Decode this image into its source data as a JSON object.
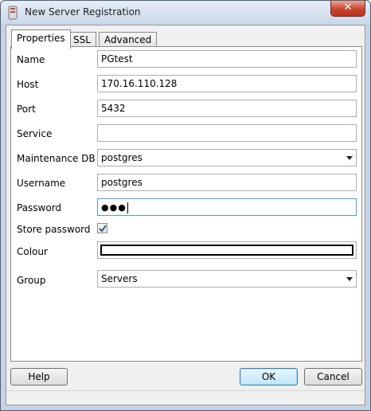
{
  "window": {
    "title": "New Server Registration",
    "close_glyph": "✕"
  },
  "tabs": [
    {
      "label": "Properties"
    },
    {
      "label": "SSL"
    },
    {
      "label": "Advanced"
    }
  ],
  "form": {
    "name": {
      "label": "Name",
      "value": "PGtest"
    },
    "host": {
      "label": "Host",
      "value": "170.16.110.128"
    },
    "port": {
      "label": "Port",
      "value": "5432"
    },
    "service": {
      "label": "Service",
      "value": ""
    },
    "maintenance_db": {
      "label": "Maintenance DB",
      "value": "postgres"
    },
    "username": {
      "label": "Username",
      "value": "postgres"
    },
    "password": {
      "label": "Password",
      "value": "●●●"
    },
    "store_password": {
      "label": "Store password",
      "checked": true
    },
    "colour": {
      "label": "Colour",
      "value": "#ffffff"
    },
    "group": {
      "label": "Group",
      "value": "Servers"
    }
  },
  "buttons": {
    "help": "Help",
    "ok": "OK",
    "cancel": "Cancel"
  }
}
